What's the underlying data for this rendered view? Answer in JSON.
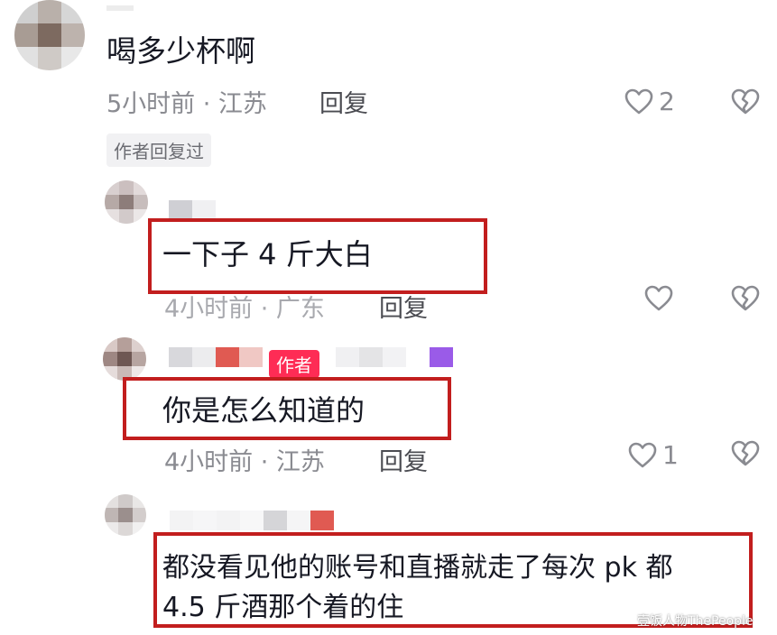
{
  "comments": [
    {
      "text": "喝多少杯啊",
      "meta": "5小时前 · 江苏",
      "reply_label": "回复",
      "like_count": "2",
      "tag": "作者回复过"
    },
    {
      "text": "一下子 4 斤大白",
      "meta": "4小时前 · 广东",
      "reply_label": "回复"
    },
    {
      "text": "你是怎么知道的",
      "meta": "4小时前 · 江苏",
      "reply_label": "回复",
      "like_count": "1",
      "author_badge": "作者"
    },
    {
      "text_line1": "都没看见他的账号和直播就走了每次 pk 都",
      "text_line2": "4.5 斤酒那个着的住"
    }
  ],
  "watermark": "壹饭人物ThePeople",
  "colors": {
    "highlight_border": "#c21e1e",
    "author_badge": "#fe2c55",
    "meta_text": "#8a8b91"
  },
  "icons": {
    "like": "heart-outline-icon",
    "dislike": "broken-heart-icon"
  }
}
